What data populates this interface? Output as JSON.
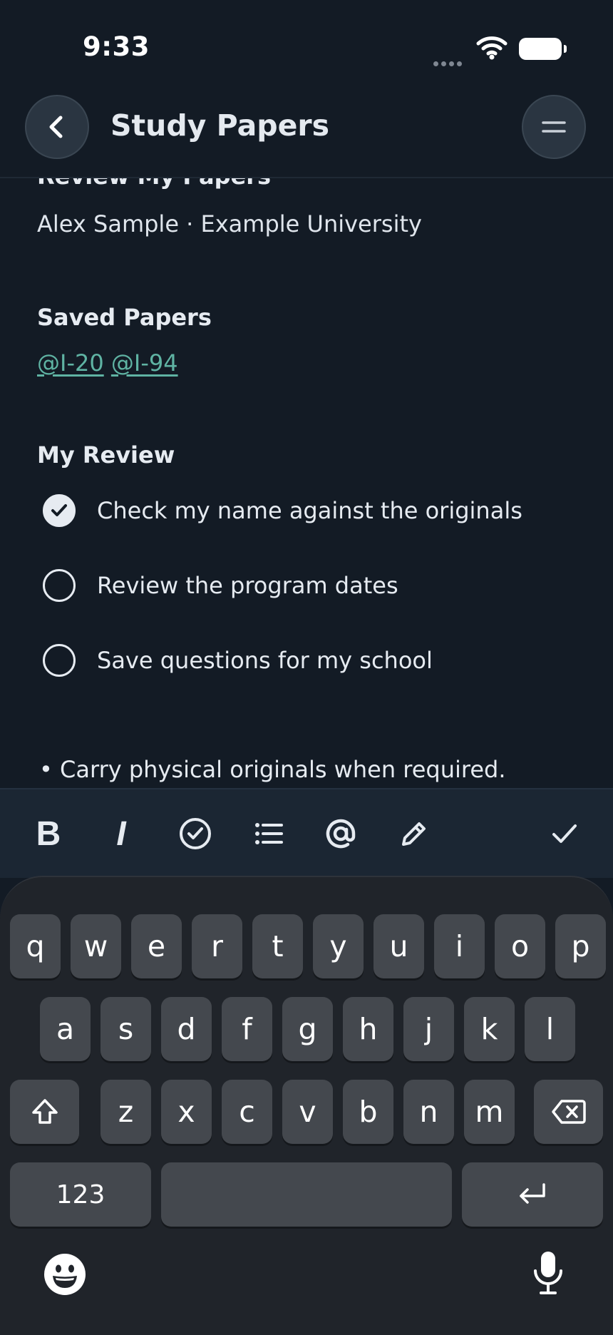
{
  "status_bar": {
    "time": "9:33"
  },
  "nav": {
    "title": "Study Papers"
  },
  "note": {
    "clipped_heading": "Review My Papers",
    "subtitle": "Alex Sample · Example University",
    "saved_heading": "Saved Papers",
    "mentions": [
      "@I-20",
      "@I-94"
    ],
    "review_heading": "My Review",
    "todos": [
      {
        "text": "Check my name against the originals",
        "checked": true
      },
      {
        "text": "Review the program dates",
        "checked": false
      },
      {
        "text": "Save questions for my school",
        "checked": false
      }
    ],
    "bullet": "• Carry physical originals when required."
  },
  "toolbar": {
    "bold_label": "B",
    "italic_label": "I",
    "icons": [
      "checkbox-icon",
      "list-icon",
      "at-icon",
      "pencil-icon",
      "done-check-icon"
    ]
  },
  "keyboard": {
    "row1": [
      "q",
      "w",
      "e",
      "r",
      "t",
      "y",
      "u",
      "i",
      "o",
      "p"
    ],
    "row2": [
      "a",
      "s",
      "d",
      "f",
      "g",
      "h",
      "j",
      "k",
      "l"
    ],
    "row3": [
      "z",
      "x",
      "c",
      "v",
      "b",
      "n",
      "m"
    ],
    "numbers_label": "123",
    "icons": [
      "shift-icon",
      "delete-icon",
      "return-icon",
      "emoji-icon",
      "microphone-icon"
    ]
  },
  "colors": {
    "background": "#131b25",
    "accent_link": "#5fb3a3",
    "keyboard_bg": "#20242a",
    "key_bg": "#44484e"
  }
}
